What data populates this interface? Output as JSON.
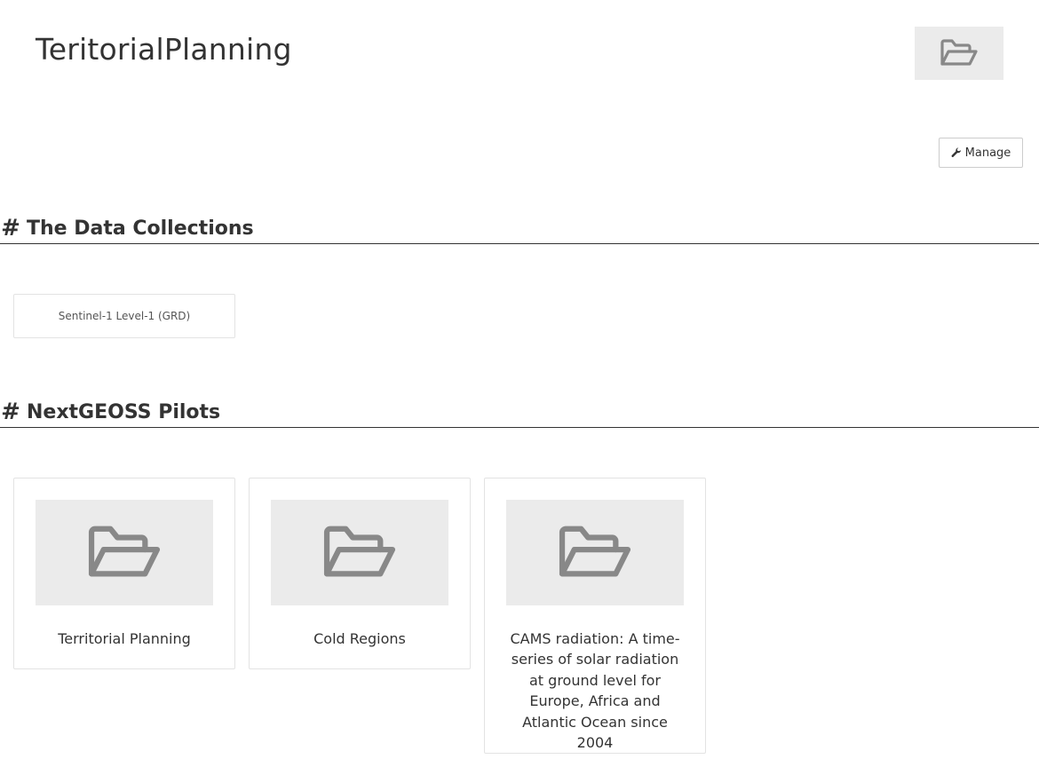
{
  "header": {
    "title": "TeritorialPlanning",
    "thumbnail_icon": "folder-open-icon"
  },
  "toolbar": {
    "manage_label": "Manage",
    "manage_icon": "wrench-icon"
  },
  "sections": {
    "collections": {
      "hash": "#",
      "title": "The Data Collections",
      "items": [
        {
          "label": "Sentinel-1 Level-1 (GRD)"
        }
      ]
    },
    "pilots": {
      "hash": "#",
      "title": "NextGEOSS Pilots",
      "items": [
        {
          "label": "Territorial Planning",
          "icon": "folder-open-icon"
        },
        {
          "label": "Cold Regions",
          "icon": "folder-open-icon"
        },
        {
          "label": "CAMS radiation: A time-series of solar radiation at ground level for Europe, Africa and Atlantic Ocean since 2004",
          "icon": "folder-open-icon"
        }
      ]
    }
  },
  "colors": {
    "text": "#333333",
    "thumbnail_bg": "#ebebeb",
    "icon": "#888888",
    "card_border": "#e3e3e3"
  }
}
